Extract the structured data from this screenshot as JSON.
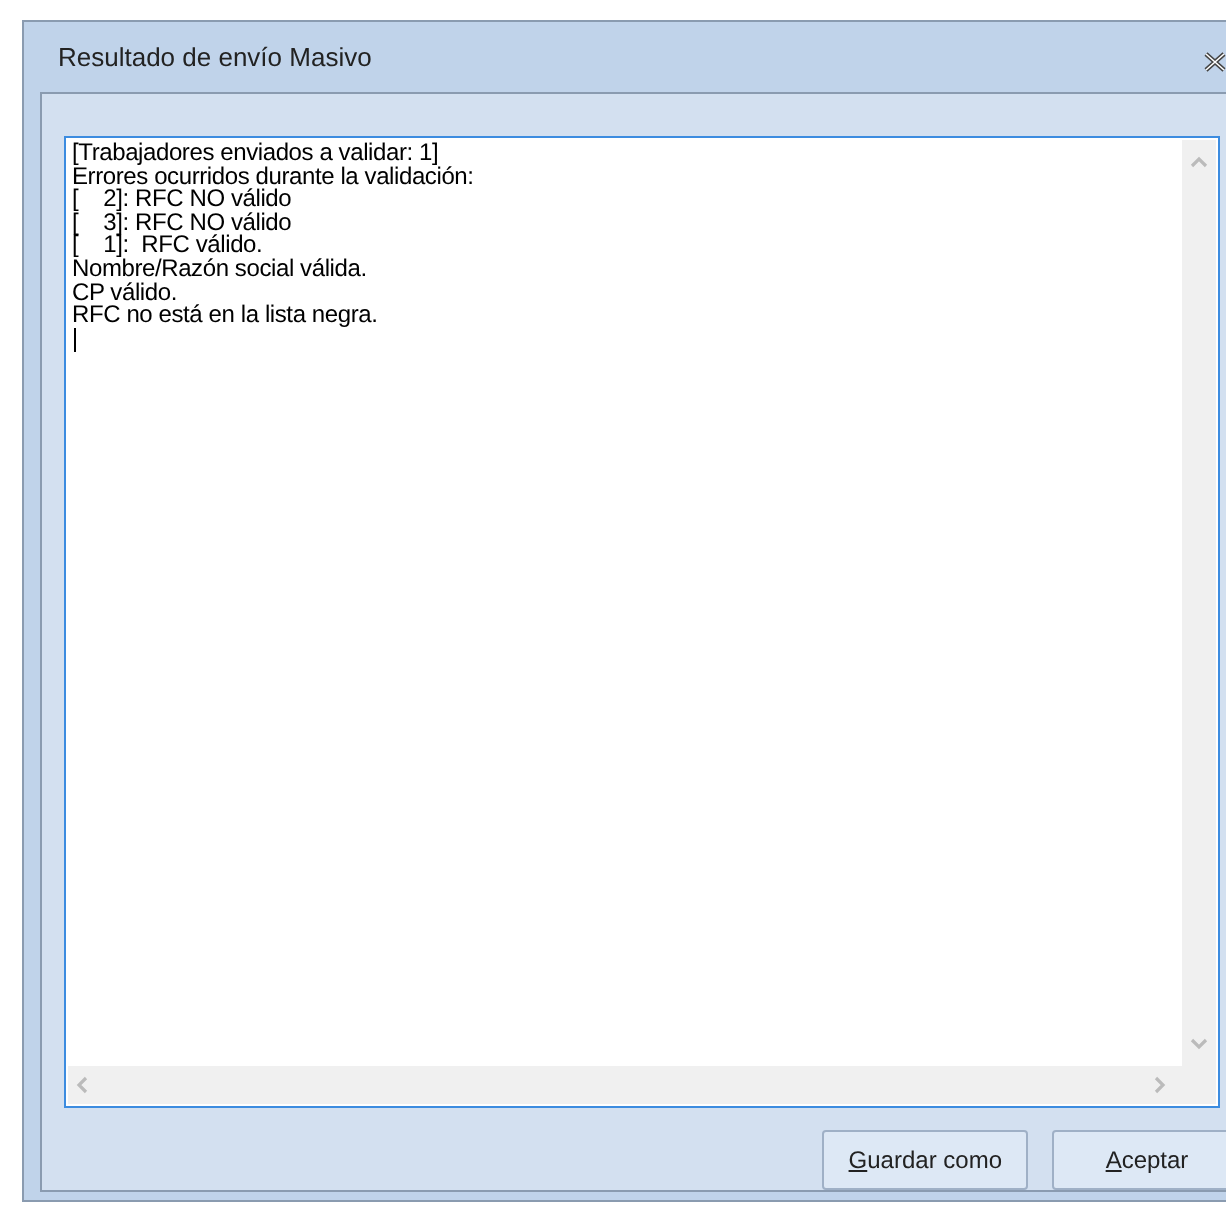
{
  "window": {
    "title": "Resultado de envío Masivo"
  },
  "log": {
    "lines": [
      "[Trabajadores enviados a validar: 1]",
      "Errores ocurridos durante la validación:",
      "[\t2]: RFC NO válido",
      "[\t3]: RFC NO válido",
      "[\t1]:  RFC válido.",
      "Nombre/Razón social válida.",
      "CP válido.",
      "RFC no está en la lista negra."
    ]
  },
  "buttons": [
    {
      "label": "Guardar como"
    },
    {
      "label": "Aceptar"
    }
  ]
}
